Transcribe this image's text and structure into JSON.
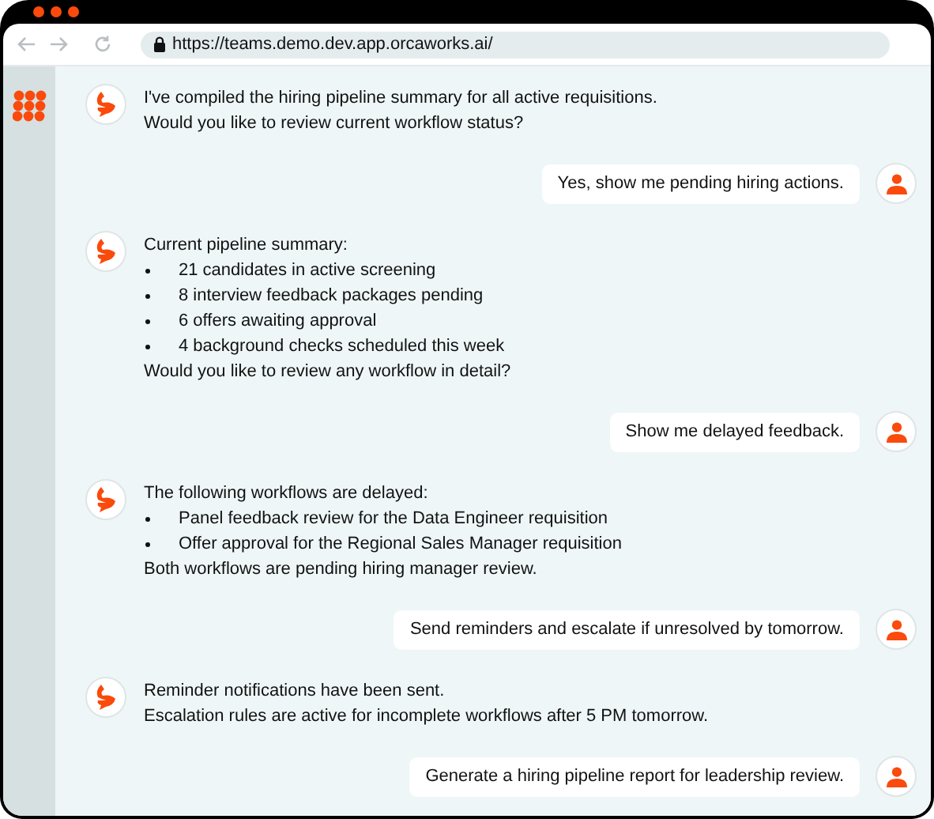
{
  "browser": {
    "url": "https://teams.demo.dev.app.orcaworks.ai/"
  },
  "messages": [
    {
      "kind": "bot",
      "lines": [
        {
          "kind": "text",
          "text": "I've compiled the hiring pipeline summary for all active requisitions."
        },
        {
          "kind": "text",
          "text": "Would you like to review current workflow status?"
        }
      ]
    },
    {
      "kind": "user",
      "text": "Yes, show me pending hiring actions."
    },
    {
      "kind": "bot",
      "lines": [
        {
          "kind": "text",
          "text": "Current pipeline summary:"
        },
        {
          "kind": "bullet",
          "text": "21 candidates in active screening"
        },
        {
          "kind": "bullet",
          "text": "8 interview feedback packages pending"
        },
        {
          "kind": "bullet",
          "text": "6 offers awaiting approval"
        },
        {
          "kind": "bullet",
          "text": "4 background checks scheduled this week"
        },
        {
          "kind": "text",
          "text": "Would you like to review any workflow in detail?"
        }
      ]
    },
    {
      "kind": "user",
      "text": "Show me delayed feedback."
    },
    {
      "kind": "bot",
      "lines": [
        {
          "kind": "text",
          "text": "The following workflows are delayed:"
        },
        {
          "kind": "bullet",
          "text": "Panel feedback review for the Data Engineer requisition"
        },
        {
          "kind": "bullet",
          "text": "Offer approval for the Regional Sales Manager requisition"
        },
        {
          "kind": "text",
          "text": "Both workflows are pending hiring manager review."
        }
      ]
    },
    {
      "kind": "user",
      "text": "Send reminders and escalate if unresolved by tomorrow."
    },
    {
      "kind": "bot",
      "lines": [
        {
          "kind": "text",
          "text": "Reminder notifications have been sent."
        },
        {
          "kind": "text",
          "text": "Escalation rules are active for incomplete workflows after 5 PM tomorrow."
        }
      ]
    },
    {
      "kind": "user",
      "text": "Generate a hiring pipeline report for leadership review."
    }
  ]
}
